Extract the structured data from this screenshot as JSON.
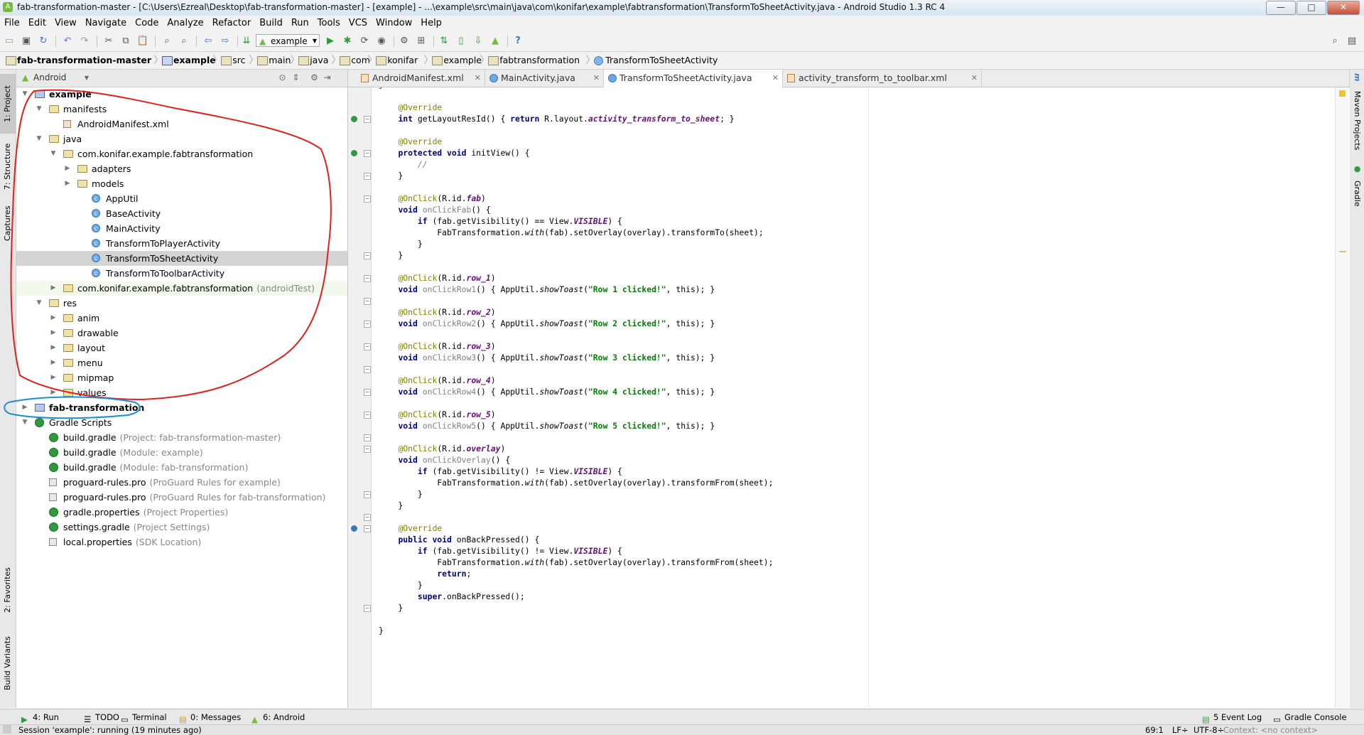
{
  "window": {
    "title": "fab-transformation-master - [C:\\Users\\Ezreal\\Desktop\\fab-transformation-master] - [example] - ...\\example\\src\\main\\java\\com\\konifar\\example\\fabtransformation\\TransformToSheetActivity.java - Android Studio 1.3 RC 4",
    "minimize": "—",
    "maximize": "□",
    "close": "✕"
  },
  "menu": [
    "File",
    "Edit",
    "View",
    "Navigate",
    "Code",
    "Analyze",
    "Refactor",
    "Build",
    "Run",
    "Tools",
    "VCS",
    "Window",
    "Help"
  ],
  "toolbar": {
    "run_config": "example",
    "help": "?"
  },
  "breadcrumb": [
    {
      "label": "fab-transformation-master",
      "kind": "folder",
      "bold": true
    },
    {
      "label": "example",
      "kind": "module",
      "bold": true
    },
    {
      "label": "src",
      "kind": "folder"
    },
    {
      "label": "main",
      "kind": "folder"
    },
    {
      "label": "java",
      "kind": "folder"
    },
    {
      "label": "com",
      "kind": "folder"
    },
    {
      "label": "konifar",
      "kind": "folder"
    },
    {
      "label": "example",
      "kind": "folder"
    },
    {
      "label": "fabtransformation",
      "kind": "folder"
    },
    {
      "label": "TransformToSheetActivity",
      "kind": "class"
    }
  ],
  "left_strip": {
    "project": "1: Project",
    "structure": "7: Structure",
    "captures": "Captures",
    "favorites": "2: Favorites",
    "build_variants": "Build Variants"
  },
  "right_strip": {
    "maven": "Maven Projects",
    "gradle": "Gradle"
  },
  "project_panel": {
    "view": "Android",
    "tree": [
      {
        "label": "example",
        "indent": 0,
        "arrow": "open",
        "icon": "modfolder",
        "bold": true
      },
      {
        "label": "manifests",
        "indent": 1,
        "arrow": "open",
        "icon": "folder"
      },
      {
        "label": "AndroidManifest.xml",
        "indent": 2,
        "arrow": "",
        "icon": "xml"
      },
      {
        "label": "java",
        "indent": 1,
        "arrow": "open",
        "icon": "folder"
      },
      {
        "label": "com.konifar.example.fabtransformation",
        "indent": 2,
        "arrow": "open",
        "icon": "folder"
      },
      {
        "label": "adapters",
        "indent": 3,
        "arrow": "closed",
        "icon": "folder"
      },
      {
        "label": "models",
        "indent": 3,
        "arrow": "closed",
        "icon": "folder"
      },
      {
        "label": "AppUtil",
        "indent": 4,
        "arrow": "",
        "icon": "cls"
      },
      {
        "label": "BaseActivity",
        "indent": 4,
        "arrow": "",
        "icon": "cls"
      },
      {
        "label": "MainActivity",
        "indent": 4,
        "arrow": "",
        "icon": "cls"
      },
      {
        "label": "TransformToPlayerActivity",
        "indent": 4,
        "arrow": "",
        "icon": "cls"
      },
      {
        "label": "TransformToSheetActivity",
        "indent": 4,
        "arrow": "",
        "icon": "cls",
        "selected": true
      },
      {
        "label": "TransformToToolbarActivity",
        "indent": 4,
        "arrow": "",
        "icon": "cls"
      },
      {
        "label": "com.konifar.example.fabtransformation",
        "suffix": "(androidTest)",
        "indent": 2,
        "arrow": "closed",
        "icon": "folder",
        "test": true
      },
      {
        "label": "res",
        "indent": 1,
        "arrow": "open",
        "icon": "folder"
      },
      {
        "label": "anim",
        "indent": 2,
        "arrow": "closed",
        "icon": "folder"
      },
      {
        "label": "drawable",
        "indent": 2,
        "arrow": "closed",
        "icon": "folder"
      },
      {
        "label": "layout",
        "indent": 2,
        "arrow": "closed",
        "icon": "folder"
      },
      {
        "label": "menu",
        "indent": 2,
        "arrow": "closed",
        "icon": "folder"
      },
      {
        "label": "mipmap",
        "indent": 2,
        "arrow": "closed",
        "icon": "folder"
      },
      {
        "label": "values",
        "indent": 2,
        "arrow": "closed",
        "icon": "folder"
      },
      {
        "label": "fab-transformation",
        "indent": 0,
        "arrow": "closed",
        "icon": "modfolder",
        "bold": true
      },
      {
        "label": "Gradle Scripts",
        "indent": 0,
        "arrow": "open",
        "icon": "gradle"
      },
      {
        "label": "build.gradle",
        "suffix": "(Project: fab-transformation-master)",
        "indent": 1,
        "arrow": "",
        "icon": "gradle"
      },
      {
        "label": "build.gradle",
        "suffix": "(Module: example)",
        "indent": 1,
        "arrow": "",
        "icon": "gradle"
      },
      {
        "label": "build.gradle",
        "suffix": "(Module: fab-transformation)",
        "indent": 1,
        "arrow": "",
        "icon": "gradle"
      },
      {
        "label": "proguard-rules.pro",
        "suffix": "(ProGuard Rules for example)",
        "indent": 1,
        "arrow": "",
        "icon": "prop"
      },
      {
        "label": "proguard-rules.pro",
        "suffix": "(ProGuard Rules for fab-transformation)",
        "indent": 1,
        "arrow": "",
        "icon": "prop"
      },
      {
        "label": "gradle.properties",
        "suffix": "(Project Properties)",
        "indent": 1,
        "arrow": "",
        "icon": "gradle"
      },
      {
        "label": "settings.gradle",
        "suffix": "(Project Settings)",
        "indent": 1,
        "arrow": "",
        "icon": "gradle"
      },
      {
        "label": "local.properties",
        "suffix": "(SDK Location)",
        "indent": 1,
        "arrow": "",
        "icon": "prop"
      }
    ]
  },
  "editor_tabs": [
    {
      "label": "AndroidManifest.xml",
      "kind": "xml"
    },
    {
      "label": "MainActivity.java",
      "kind": "cls"
    },
    {
      "label": "TransformToSheetActivity.java",
      "kind": "cls",
      "active": true
    },
    {
      "label": "activity_transform_to_toolbar.xml",
      "kind": "xml"
    }
  ],
  "code": [
    "}",
    "",
    "    @Override",
    "    int getLayoutResId() { return R.layout.activity_transform_to_sheet; }",
    "",
    "    @Override",
    "    protected void initView() {",
    "        //",
    "    }",
    "",
    "    @OnClick(R.id.fab)",
    "    void onClickFab() {",
    "        if (fab.getVisibility() == View.VISIBLE) {",
    "            FabTransformation.with(fab).setOverlay(overlay).transformTo(sheet);",
    "        }",
    "    }",
    "",
    "    @OnClick(R.id.row_1)",
    "    void onClickRow1() { AppUtil.showToast(\"Row 1 clicked!\", this); }",
    "",
    "    @OnClick(R.id.row_2)",
    "    void onClickRow2() { AppUtil.showToast(\"Row 2 clicked!\", this); }",
    "",
    "    @OnClick(R.id.row_3)",
    "    void onClickRow3() { AppUtil.showToast(\"Row 3 clicked!\", this); }",
    "",
    "    @OnClick(R.id.row_4)",
    "    void onClickRow4() { AppUtil.showToast(\"Row 4 clicked!\", this); }",
    "",
    "    @OnClick(R.id.row_5)",
    "    void onClickRow5() { AppUtil.showToast(\"Row 5 clicked!\", this); }",
    "",
    "    @OnClick(R.id.overlay)",
    "    void onClickOverlay() {",
    "        if (fab.getVisibility() != View.VISIBLE) {",
    "            FabTransformation.with(fab).setOverlay(overlay).transformFrom(sheet);",
    "        }",
    "    }",
    "",
    "    @Override",
    "    public void onBackPressed() {",
    "        if (fab.getVisibility() != View.VISIBLE) {",
    "            FabTransformation.with(fab).setOverlay(overlay).transformFrom(sheet);",
    "            return;",
    "        }",
    "        super.onBackPressed();",
    "    }",
    "",
    "}"
  ],
  "bottom_tabs": {
    "run": "4: Run",
    "todo": "TODO",
    "terminal": "Terminal",
    "messages": "0: Messages",
    "android": "6: Android",
    "event_log": "5 Event Log",
    "gradle_console": "Gradle Console"
  },
  "status": {
    "message": "Session 'example': running (19 minutes ago)",
    "position": "69:1",
    "line_sep": "LF÷",
    "encoding": "UTF-8÷",
    "context": "Context: <no context>"
  },
  "colors": {
    "annotation_red": "#e0201c",
    "annotation_blue": "#1a8fd8",
    "selection": "#d4d4d4",
    "keyword": "#000080",
    "string": "#008000"
  }
}
